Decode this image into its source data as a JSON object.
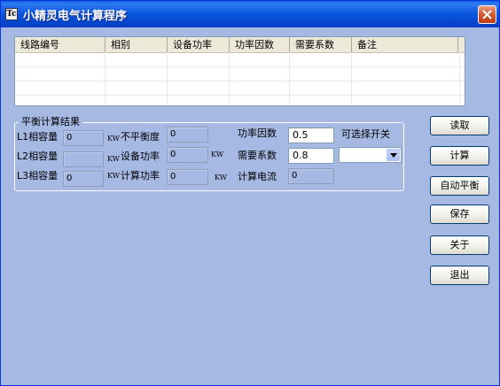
{
  "window": {
    "title": "小精灵电气计算程序",
    "icon_glyph": "Tc"
  },
  "list": {
    "columns": [
      "线路编号",
      "相别",
      "设备功率",
      "功率因数",
      "需要系数",
      "备注"
    ]
  },
  "group": {
    "title": "平衡计算结果",
    "l1_label": "L1相容量",
    "l1_value": "0",
    "l2_label": "L2相容量",
    "l2_value": "",
    "l3_label": "L3相容量",
    "l3_value": "0",
    "unit_kw": "KW",
    "unbalance_label": "不平衡度",
    "unbalance_value": "0",
    "equip_power_label": "设备功率",
    "equip_power_value": "0",
    "calc_power_label": "计算功率",
    "calc_power_value": "0",
    "pf_label": "功率因数",
    "pf_value": "0.5",
    "demand_label": "需要系数",
    "demand_value": "0.8",
    "current_label": "计算电流",
    "current_value": "0",
    "switch_label": "可选择开关",
    "switch_selected": ""
  },
  "buttons": {
    "read": "读取",
    "calc": "计算",
    "auto_balance": "自动平衡",
    "save": "保存",
    "about": "关于",
    "exit": "退出"
  },
  "colors": {
    "window_bg": "#a6b9e3",
    "title_bar": "#0a58e0",
    "close_button": "#d2542c"
  }
}
